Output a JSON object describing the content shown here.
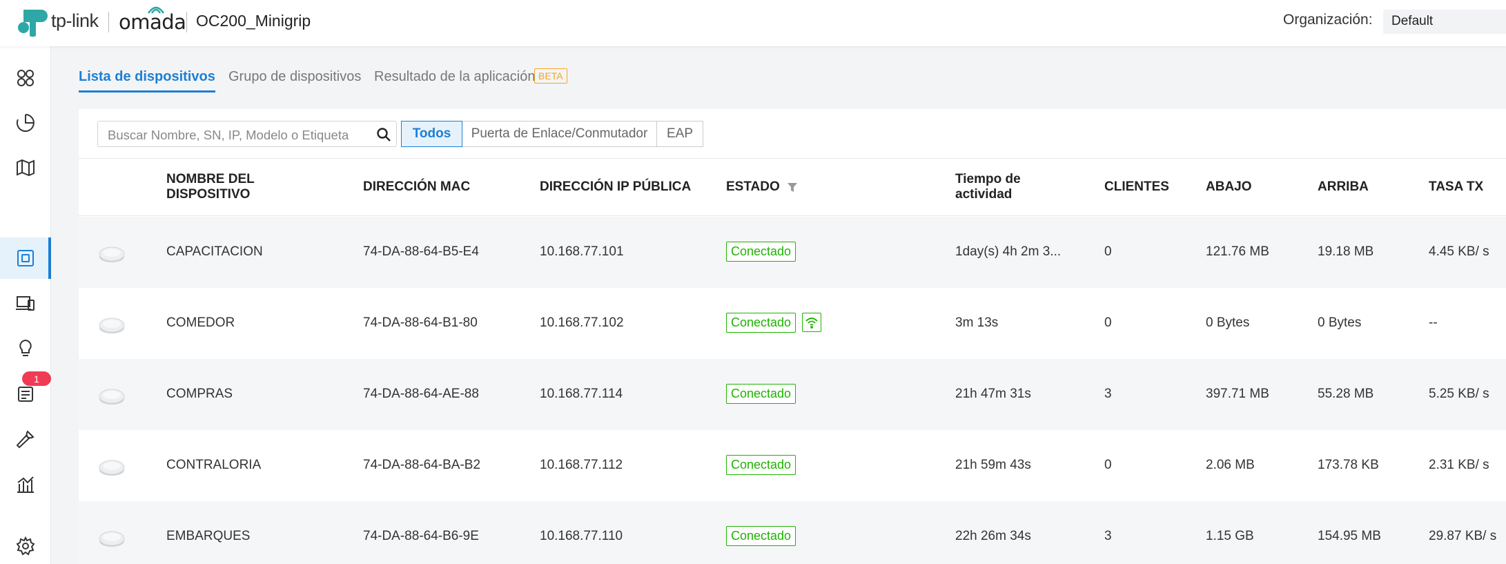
{
  "header": {
    "brand_tplink": "tp-link",
    "brand_omada": "omada",
    "site_name": "OC200_Minigrip",
    "org_label": "Organización:",
    "org_value": "Default"
  },
  "sidebar": {
    "items": [
      {
        "icon": "dashboard-icon"
      },
      {
        "icon": "statistics-icon"
      },
      {
        "icon": "map-icon"
      },
      {
        "icon": "devices-icon",
        "active": true
      },
      {
        "icon": "clients-icon"
      },
      {
        "icon": "insight-icon"
      },
      {
        "icon": "logs-icon",
        "badge": "1"
      },
      {
        "icon": "tools-icon"
      },
      {
        "icon": "reports-icon"
      },
      {
        "icon": "settings-icon"
      }
    ]
  },
  "tabs": {
    "device_list": "Lista de dispositivos",
    "device_group": "Grupo de dispositivos",
    "app_result": "Resultado de la aplicación",
    "beta": "BETA"
  },
  "toolbar": {
    "search_placeholder": "Buscar Nombre, SN, IP, Modelo o Etiqueta",
    "filters": [
      "Todos",
      "Puerta de Enlace/Conmutador",
      "EAP"
    ]
  },
  "table": {
    "headers": {
      "name": "NOMBRE DEL DISPOSITIVO",
      "mac": "DIRECCIÓN MAC",
      "ip": "DIRECCIÓN IP PÚBLICA",
      "status": "ESTADO",
      "uptime": "Tiempo de actividad",
      "clients": "CLIENTES",
      "down": "ABAJO",
      "up": "ARRIBA",
      "tx": "TASA TX"
    },
    "rows": [
      {
        "name": "CAPACITACION",
        "mac": "74-DA-88-64-B5-E4",
        "ip": "10.168.77.101",
        "status": "Conectado",
        "wifi": false,
        "uptime": "1day(s) 4h 2m 3...",
        "clients": "0",
        "down": "121.76 MB",
        "up": "19.18 MB",
        "tx": "4.45 KB/ s"
      },
      {
        "name": "COMEDOR",
        "mac": "74-DA-88-64-B1-80",
        "ip": "10.168.77.102",
        "status": "Conectado",
        "wifi": true,
        "uptime": "3m 13s",
        "clients": "0",
        "down": "0 Bytes",
        "up": "0 Bytes",
        "tx": "--"
      },
      {
        "name": "COMPRAS",
        "mac": "74-DA-88-64-AE-88",
        "ip": "10.168.77.114",
        "status": "Conectado",
        "wifi": false,
        "uptime": "21h 47m 31s",
        "clients": "3",
        "down": "397.71 MB",
        "up": "55.28 MB",
        "tx": "5.25 KB/ s"
      },
      {
        "name": "CONTRALORIA",
        "mac": "74-DA-88-64-BA-B2",
        "ip": "10.168.77.112",
        "status": "Conectado",
        "wifi": false,
        "uptime": "21h 59m 43s",
        "clients": "0",
        "down": "2.06 MB",
        "up": "173.78 KB",
        "tx": "2.31 KB/ s"
      },
      {
        "name": "EMBARQUES",
        "mac": "74-DA-88-64-B6-9E",
        "ip": "10.168.77.110",
        "status": "Conectado",
        "wifi": false,
        "uptime": "22h 26m 34s",
        "clients": "3",
        "down": "1.15 GB",
        "up": "154.95 MB",
        "tx": "29.87 KB/ s"
      }
    ]
  },
  "colors": {
    "accent": "#1b7fd4",
    "brand_teal": "#2ea7a7",
    "status_ok": "#1eb200",
    "badge": "#f03b55",
    "beta": "#f5a524"
  }
}
